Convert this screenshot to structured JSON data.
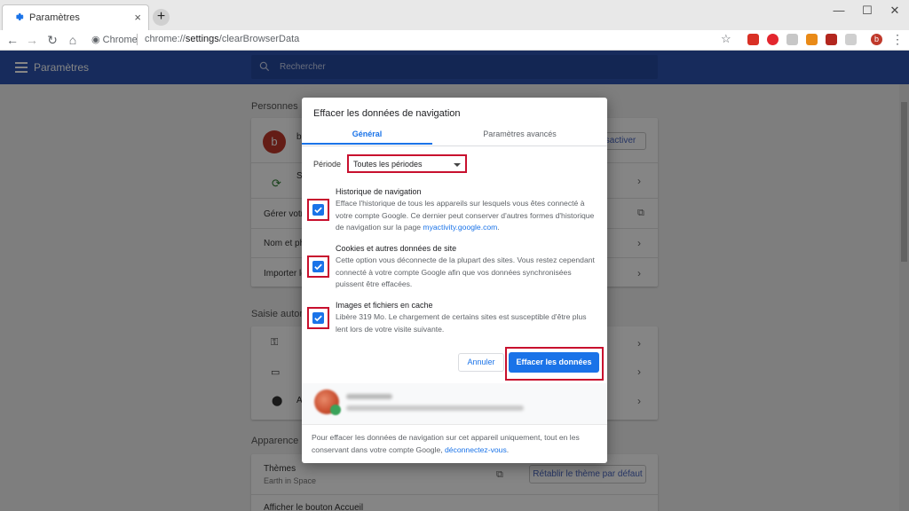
{
  "browser": {
    "tab_title": "Paramètres",
    "tab_close": "×",
    "new_tab": "+",
    "window_controls": {
      "minimize": "—",
      "maximize": "☐",
      "close": "✕"
    },
    "nav": {
      "back": "←",
      "forward": "→",
      "reload": "↻",
      "home": "⌂"
    },
    "omnibox": {
      "site_label": "Chrome",
      "url_prefix": "chrome://",
      "url_host": "settings",
      "url_path": "/clearBrowserData"
    },
    "star": "☆",
    "menu": "⋮",
    "extensions": [
      {
        "name": "ext-red-badge",
        "color": "#d93025"
      },
      {
        "name": "ext-red-download",
        "color": "#e3262e"
      },
      {
        "name": "ext-gray-arrows",
        "color": "#c7c7c7"
      },
      {
        "name": "ext-orange-key",
        "color": "#e98a17"
      },
      {
        "name": "ext-dark-red",
        "color": "#b3261e"
      },
      {
        "name": "ext-gray-box",
        "color": "#cfcfcf"
      },
      {
        "name": "ext-profile",
        "color": "#c0392b"
      }
    ],
    "profile_letter": "b"
  },
  "settings": {
    "app_title": "Paramètres",
    "search_placeholder": "Rechercher",
    "sections": {
      "people": {
        "title": "Personnes",
        "avatar_letter": "b",
        "avatar_name": "b",
        "sync_letter": "S",
        "deactivate_btn": "sactiver",
        "rows": [
          "Gérer votre",
          "Nom et ph",
          "Importer le"
        ]
      },
      "autofill": {
        "title": "Saisie autom",
        "row_first_letter": "A"
      },
      "appearance": {
        "title": "Apparence",
        "themes_label": "Thèmes",
        "themes_value": "Earth in Space",
        "reset_theme_btn": "Rétablir le thème par défaut",
        "home_button_label": "Afficher le bouton Accueil"
      }
    }
  },
  "dialog": {
    "title": "Effacer les données de navigation",
    "tabs": [
      {
        "label": "Général",
        "active": true
      },
      {
        "label": "Paramètres avancés",
        "active": false
      }
    ],
    "period_label": "Période",
    "period_value": "Toutes les périodes",
    "options": [
      {
        "title": "Historique de navigation",
        "desc": "Efface l'historique de tous les appareils sur lesquels vous êtes connecté à votre compte Google. Ce dernier peut conserver d'autres formes d'historique de navigation sur la page ",
        "link": "myactivity.google.com",
        "desc_end": ".",
        "checked": true
      },
      {
        "title": "Cookies et autres données de site",
        "desc": "Cette option vous déconnecte de la plupart des sites. Vous restez cependant connecté à votre compte Google afin que vos données synchronisées puissent être effacées.",
        "checked": true
      },
      {
        "title": "Images et fichiers en cache",
        "desc": "Libère 319 Mo. Le chargement de certains sites est susceptible d'être plus lent lors de votre visite suivante.",
        "checked": true
      }
    ],
    "cancel_label": "Annuler",
    "confirm_label": "Effacer les données",
    "footer": {
      "text": "Pour effacer les données de navigation sur cet appareil uniquement, tout en les conservant dans votre compte Google, ",
      "link": "déconnectez-vous",
      "end": "."
    }
  },
  "colors": {
    "accent": "#1a73e8",
    "appbar": "#2c54b1",
    "highlight": "#c8102e"
  }
}
